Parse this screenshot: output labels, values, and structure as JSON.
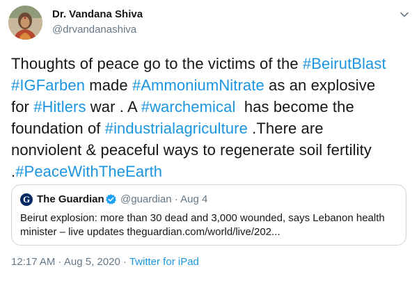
{
  "author": {
    "name": "Dr. Vandana Shiva",
    "handle": "@drvandanashiva"
  },
  "tweet": {
    "lines": [
      [
        {
          "text": "Thoughts of peace go to the victims of the ",
          "hashtag": false
        },
        {
          "text": "#BeirutBlast",
          "hashtag": true
        }
      ],
      [
        {
          "text": "#IGFarben",
          "hashtag": true
        },
        {
          "text": " made ",
          "hashtag": false
        },
        {
          "text": "#AmmoniumNitrate",
          "hashtag": true
        },
        {
          "text": " as an explosive",
          "hashtag": false
        }
      ],
      [
        {
          "text": "for ",
          "hashtag": false
        },
        {
          "text": "#Hitlers",
          "hashtag": true
        },
        {
          "text": " war . A ",
          "hashtag": false
        },
        {
          "text": "#warchemical",
          "hashtag": true
        },
        {
          "text": "  has become the",
          "hashtag": false
        }
      ],
      [
        {
          "text": "foundation of ",
          "hashtag": false
        },
        {
          "text": "#industrialagriculture",
          "hashtag": true
        },
        {
          "text": " .There are",
          "hashtag": false
        }
      ],
      [
        {
          "text": "nonviolent & peaceful ways to regenerate soil fertility",
          "hashtag": false
        }
      ],
      [
        {
          "text": ".",
          "hashtag": false
        },
        {
          "text": "#PeaceWithTheEarth",
          "hashtag": true
        }
      ]
    ]
  },
  "quoted": {
    "logo_letter": "G",
    "name": "The Guardian",
    "handle_date": "@guardian · Aug 4",
    "text_lines": [
      "Beirut explosion: more than 30 dead and 3,000 wounded, says Lebanon health",
      "minister – live updates theguardian.com/world/live/202..."
    ]
  },
  "meta": {
    "timestamp": "12:17 AM · Aug 5, 2020 · ",
    "source": "Twitter for iPad"
  },
  "icons": {
    "caret": "chevron-down-icon",
    "verified": "verified-badge-icon"
  },
  "colors": {
    "hashtag": "#1b95e0",
    "secondary_text": "#657786",
    "border": "#ccd6dd",
    "guardian_blue": "#052962"
  }
}
